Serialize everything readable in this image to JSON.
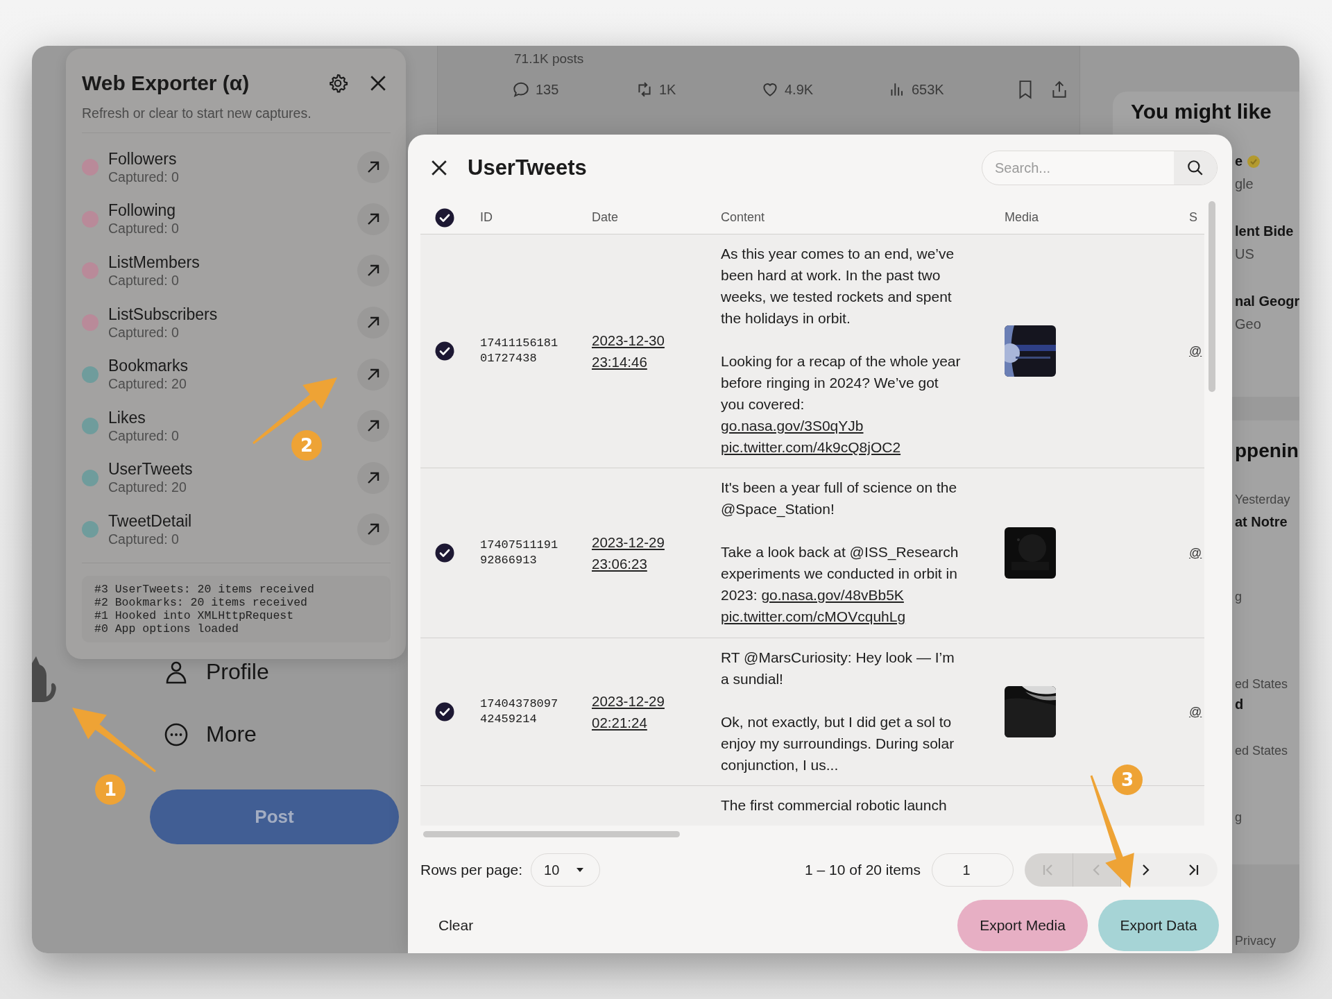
{
  "background": {
    "timeline": {
      "post_count": "71.1K posts",
      "stats": [
        {
          "kind": "reply",
          "value": "135"
        },
        {
          "kind": "repost",
          "value": "1K"
        },
        {
          "kind": "like",
          "value": "4.9K"
        },
        {
          "kind": "views",
          "value": "653K"
        }
      ]
    },
    "nav": [
      {
        "kind": "profile",
        "label": "Profile"
      },
      {
        "kind": "more",
        "label": "More"
      }
    ],
    "post_button": {
      "label": "Post"
    },
    "sidebar": {
      "title": "You might like",
      "fragments": [
        {
          "text": "e",
          "kind": "name",
          "verified": true
        },
        {
          "text": "gle",
          "kind": "handle"
        },
        {
          "text": "lent Bide",
          "kind": "name"
        },
        {
          "text": "US",
          "kind": "handle"
        },
        {
          "text": "nal Geogr",
          "kind": "name"
        },
        {
          "text": "Geo",
          "kind": "handle"
        },
        {
          "text": "ppenin",
          "kind": "heading"
        },
        {
          "text": "Yesterday",
          "kind": "meta"
        },
        {
          "text": "at Notre",
          "kind": "name"
        },
        {
          "text": "g",
          "kind": "meta"
        },
        {
          "text": "ed States",
          "kind": "meta"
        },
        {
          "text": "d",
          "kind": "name"
        },
        {
          "text": "ed States",
          "kind": "meta"
        },
        {
          "text": "g",
          "kind": "meta"
        },
        {
          "text": "Privacy",
          "kind": "meta"
        }
      ]
    }
  },
  "exporter": {
    "title": "Web Exporter (α)",
    "subtitle": "Refresh or clear to start new captures.",
    "modules": [
      {
        "name": "Followers",
        "captured": "Captured: 0",
        "color": "#b98a99"
      },
      {
        "name": "Following",
        "captured": "Captured: 0",
        "color": "#b98a99"
      },
      {
        "name": "ListMembers",
        "captured": "Captured: 0",
        "color": "#b98a99"
      },
      {
        "name": "ListSubscribers",
        "captured": "Captured: 0",
        "color": "#b98a99"
      },
      {
        "name": "Bookmarks",
        "captured": "Captured: 20",
        "color": "#6f9c9c"
      },
      {
        "name": "Likes",
        "captured": "Captured: 0",
        "color": "#6f9c9c"
      },
      {
        "name": "UserTweets",
        "captured": "Captured: 20",
        "color": "#6f9c9c"
      },
      {
        "name": "TweetDetail",
        "captured": "Captured: 0",
        "color": "#6f9c9c"
      }
    ],
    "log": [
      "#3 UserTweets: 20 items received",
      "#2 Bookmarks: 20 items received",
      "#1 Hooked into XMLHttpRequest",
      "#0 App options loaded"
    ]
  },
  "modal": {
    "title": "UserTweets",
    "search": {
      "placeholder": "Search..."
    },
    "select_all": {
      "checked": true
    },
    "columns": [
      {
        "label": "ID"
      },
      {
        "label": "Date"
      },
      {
        "label": "Content"
      },
      {
        "label": "Media"
      },
      {
        "label": "S"
      }
    ],
    "rows": [
      {
        "checked": true,
        "id": "1741115618101727438",
        "date": "2023-12-30 23:14:46",
        "content": [
          [
            {
              "text": "As this year comes to an end, we’ve been hard at work. In the past two weeks, we tested rockets and spent the holidays in orbit."
            }
          ],
          [
            {
              "text": "Looking for a recap of the whole year before ringing in 2024? We’ve got you covered:"
            },
            {
              "text": "go.nasa.gov/3S0qYJb",
              "link": true,
              "break_before": true
            },
            {
              "text": "pic.twitter.com/4k9cQ8jOC2",
              "link": true,
              "break_before": true
            }
          ]
        ],
        "media": {
          "kind": "picture"
        },
        "column_5": "@"
      },
      {
        "checked": true,
        "id": "1740751119192866913",
        "date": "2023-12-29 23:06:23",
        "content": [
          [
            {
              "text": "It's been a year full of science on the @Space_Station!"
            }
          ],
          [
            {
              "text": "Take a look back at @ISS_Research experiments we conducted in orbit in 2023: "
            },
            {
              "text": "go.nasa.gov/48vBb5K",
              "link": true,
              "break_before": false
            },
            {
              "text": "pic.twitter.com/cMOVcquhLg",
              "link": true,
              "break_before": true
            }
          ]
        ],
        "media": {
          "kind": "picture"
        },
        "column_5": "@"
      },
      {
        "checked": true,
        "id": "1740437809742459214",
        "date": "2023-12-29 02:21:24",
        "content": [
          [
            {
              "text": "RT @MarsCuriosity: Hey look — I’m a sundial!"
            }
          ],
          [
            {
              "text": "Ok, not exactly, but I did get a sol to enjoy my surroundings. During solar conjunction, I us..."
            }
          ]
        ],
        "media": {
          "kind": "picture"
        },
        "column_5": "@"
      },
      {
        "content": [
          [
            {
              "text": "The first commercial robotic launch"
            }
          ]
        ]
      }
    ],
    "pager": {
      "rows_per_page_label": "Rows per page:",
      "rows_per_page": "10",
      "range": "1 – 10 of 20 items",
      "page": "1",
      "buttons": [
        {
          "kind": "first",
          "disabled": true
        },
        {
          "kind": "prev",
          "disabled": true
        },
        {
          "kind": "next",
          "disabled": false
        },
        {
          "kind": "last",
          "disabled": false
        }
      ]
    },
    "footer": {
      "clear": "Clear",
      "export_media": "Export Media",
      "export_data": "Export Data"
    }
  },
  "annotations": [
    {
      "number": "1"
    },
    {
      "number": "2"
    },
    {
      "number": "3"
    }
  ]
}
